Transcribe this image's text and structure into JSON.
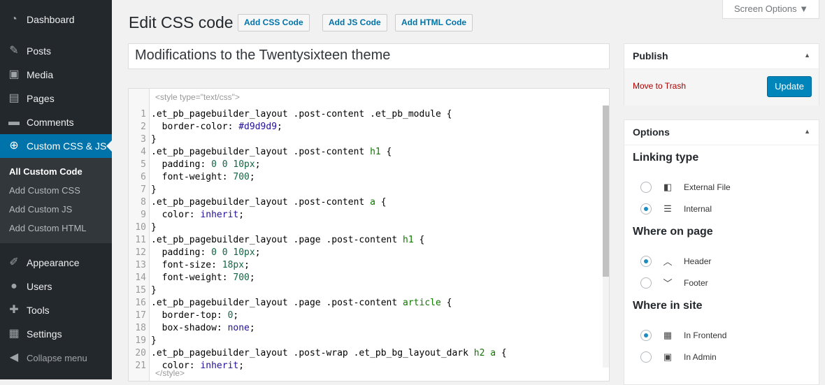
{
  "sidebar": {
    "items": [
      {
        "label": "Dashboard",
        "icon": "dashboard-icon",
        "glyph": "◔"
      },
      {
        "label": "Posts",
        "icon": "pin-icon",
        "glyph": "✎"
      },
      {
        "label": "Media",
        "icon": "media-icon",
        "glyph": "▣"
      },
      {
        "label": "Pages",
        "icon": "pages-icon",
        "glyph": "▤"
      },
      {
        "label": "Comments",
        "icon": "comment-icon",
        "glyph": "▬"
      },
      {
        "label": "Custom CSS & JS",
        "icon": "plus-circle-icon",
        "glyph": "⊕"
      }
    ],
    "submenu": [
      "All Custom Code",
      "Add Custom CSS",
      "Add Custom JS",
      "Add Custom HTML"
    ],
    "items2": [
      {
        "label": "Appearance",
        "icon": "brush-icon",
        "glyph": "✐"
      },
      {
        "label": "Users",
        "icon": "user-icon",
        "glyph": "●"
      },
      {
        "label": "Tools",
        "icon": "wrench-icon",
        "glyph": "✚"
      },
      {
        "label": "Settings",
        "icon": "settings-icon",
        "glyph": "▦"
      }
    ],
    "collapse": "Collapse menu"
  },
  "header": {
    "title": "Edit CSS code",
    "buttons": [
      "Add CSS Code",
      "Add JS Code",
      "Add HTML Code"
    ],
    "screen_options": "Screen Options ▼"
  },
  "post_title": "Modifications to the Twentysixteen theme",
  "editor": {
    "open_tag": "<style type=\"text/css\">",
    "close_tag": "</style>",
    "lines": [
      [
        [
          ".et_pb_pagebuilder_layout .post-content .et_pb_module {",
          ""
        ]
      ],
      [
        [
          "  border-color: ",
          ""
        ],
        [
          "#d9d9d9",
          "hex"
        ],
        [
          ";",
          ""
        ]
      ],
      [
        [
          "}",
          ""
        ]
      ],
      [
        [
          ".et_pb_pagebuilder_layout .post-content ",
          ""
        ],
        [
          "h1",
          "tag"
        ],
        [
          " {",
          ""
        ]
      ],
      [
        [
          "  padding: ",
          ""
        ],
        [
          "0 0 10px",
          "num"
        ],
        [
          ";",
          ""
        ]
      ],
      [
        [
          "  font-weight: ",
          ""
        ],
        [
          "700",
          "num"
        ],
        [
          ";",
          ""
        ]
      ],
      [
        [
          "}",
          ""
        ]
      ],
      [
        [
          ".et_pb_pagebuilder_layout .post-content ",
          ""
        ],
        [
          "a",
          "tag"
        ],
        [
          " {",
          ""
        ]
      ],
      [
        [
          "  color: ",
          ""
        ],
        [
          "inherit",
          "val"
        ],
        [
          ";",
          ""
        ]
      ],
      [
        [
          "}",
          ""
        ]
      ],
      [
        [
          ".et_pb_pagebuilder_layout .page .post-content ",
          ""
        ],
        [
          "h1",
          "tag"
        ],
        [
          " {",
          ""
        ]
      ],
      [
        [
          "  padding: ",
          ""
        ],
        [
          "0 0 10px",
          "num"
        ],
        [
          ";",
          ""
        ]
      ],
      [
        [
          "  font-size: ",
          ""
        ],
        [
          "18px",
          "num"
        ],
        [
          ";",
          ""
        ]
      ],
      [
        [
          "  font-weight: ",
          ""
        ],
        [
          "700",
          "num"
        ],
        [
          ";",
          ""
        ]
      ],
      [
        [
          "}",
          ""
        ]
      ],
      [
        [
          ".et_pb_pagebuilder_layout .page .post-content ",
          ""
        ],
        [
          "article",
          "tag"
        ],
        [
          " {",
          ""
        ]
      ],
      [
        [
          "  border-top: ",
          ""
        ],
        [
          "0",
          "num"
        ],
        [
          ";",
          ""
        ]
      ],
      [
        [
          "  box-shadow: ",
          ""
        ],
        [
          "none",
          "val"
        ],
        [
          ";",
          ""
        ]
      ],
      [
        [
          "}",
          ""
        ]
      ],
      [
        [
          ".et_pb_pagebuilder_layout .post-wrap .et_pb_bg_layout_dark ",
          ""
        ],
        [
          "h2 a",
          "tag"
        ],
        [
          " {",
          ""
        ]
      ],
      [
        [
          "  color: ",
          ""
        ],
        [
          "inherit",
          "val"
        ],
        [
          ";",
          ""
        ]
      ]
    ]
  },
  "publish": {
    "title": "Publish",
    "trash": "Move to Trash",
    "update": "Update"
  },
  "options": {
    "title": "Options",
    "sections": [
      {
        "title": "Linking type",
        "options": [
          {
            "label": "External File",
            "icon": "code-file-icon",
            "glyph": "◧",
            "checked": false
          },
          {
            "label": "Internal",
            "icon": "align-left-icon",
            "glyph": "☰",
            "checked": true
          }
        ]
      },
      {
        "title": "Where on page",
        "options": [
          {
            "label": "Header",
            "icon": "chevron-up-icon",
            "glyph": "︿",
            "checked": true
          },
          {
            "label": "Footer",
            "icon": "chevron-down-icon",
            "glyph": "﹀",
            "checked": false
          }
        ]
      },
      {
        "title": "Where in site",
        "options": [
          {
            "label": "In Frontend",
            "icon": "layout-icon",
            "glyph": "▦",
            "checked": true
          },
          {
            "label": "In Admin",
            "icon": "id-card-icon",
            "glyph": "▣",
            "checked": false
          }
        ]
      }
    ]
  },
  "colors": {
    "accent": "#0073aa",
    "sidebar": "#23282d",
    "update_button": "#0085ba"
  }
}
